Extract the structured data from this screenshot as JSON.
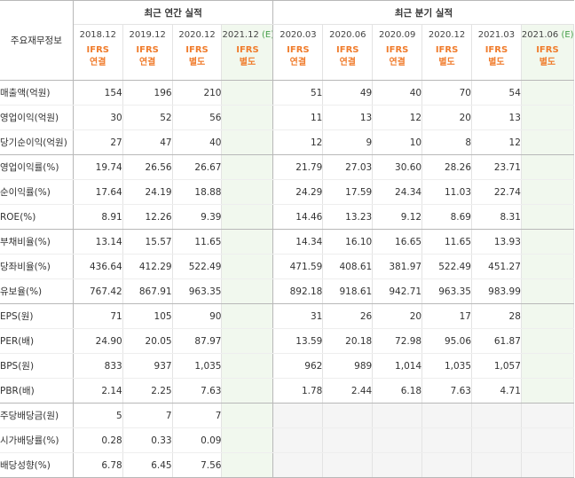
{
  "header": {
    "corner_label": "주요재무정보",
    "annual_label": "최근 연간 실적",
    "quarterly_label": "최근 분기 실적"
  },
  "periods": [
    {
      "label": "2018.12",
      "est": "",
      "acct_top": "IFRS",
      "acct_bottom": "연결",
      "group": "annual"
    },
    {
      "label": "2019.12",
      "est": "",
      "acct_top": "IFRS",
      "acct_bottom": "연결",
      "group": "annual"
    },
    {
      "label": "2020.12",
      "est": "",
      "acct_top": "IFRS",
      "acct_bottom": "별도",
      "group": "annual"
    },
    {
      "label": "2021.12",
      "est": "(E)",
      "acct_top": "IFRS",
      "acct_bottom": "별도",
      "group": "annual"
    },
    {
      "label": "2020.03",
      "est": "",
      "acct_top": "IFRS",
      "acct_bottom": "연결",
      "group": "quarterly"
    },
    {
      "label": "2020.06",
      "est": "",
      "acct_top": "IFRS",
      "acct_bottom": "연결",
      "group": "quarterly"
    },
    {
      "label": "2020.09",
      "est": "",
      "acct_top": "IFRS",
      "acct_bottom": "연결",
      "group": "quarterly"
    },
    {
      "label": "2020.12",
      "est": "",
      "acct_top": "IFRS",
      "acct_bottom": "별도",
      "group": "quarterly"
    },
    {
      "label": "2021.03",
      "est": "",
      "acct_top": "IFRS",
      "acct_bottom": "별도",
      "group": "quarterly"
    },
    {
      "label": "2021.06",
      "est": "(E)",
      "acct_top": "IFRS",
      "acct_bottom": "별도",
      "group": "quarterly"
    }
  ],
  "colors": {
    "accent_orange": "#f07c2c",
    "estimate_green": "#48a04b",
    "estimate_shade": "#f1f8ee",
    "empty_grey": "#f5f5f5"
  },
  "rows": [
    {
      "label": "매출액(억원)",
      "values": [
        "154",
        "196",
        "210",
        "",
        "51",
        "49",
        "40",
        "70",
        "54",
        ""
      ],
      "end_group": false
    },
    {
      "label": "영업이익(억원)",
      "values": [
        "30",
        "52",
        "56",
        "",
        "11",
        "13",
        "12",
        "20",
        "13",
        ""
      ],
      "end_group": false
    },
    {
      "label": "당기순이익(억원)",
      "values": [
        "27",
        "47",
        "40",
        "",
        "12",
        "9",
        "10",
        "8",
        "12",
        ""
      ],
      "end_group": true
    },
    {
      "label": "영업이익률(%)",
      "values": [
        "19.74",
        "26.56",
        "26.67",
        "",
        "21.79",
        "27.03",
        "30.60",
        "28.26",
        "23.71",
        ""
      ],
      "end_group": false
    },
    {
      "label": "순이익률(%)",
      "values": [
        "17.64",
        "24.19",
        "18.88",
        "",
        "24.29",
        "17.59",
        "24.34",
        "11.03",
        "22.74",
        ""
      ],
      "end_group": false
    },
    {
      "label": "ROE(%)",
      "values": [
        "8.91",
        "12.26",
        "9.39",
        "",
        "14.46",
        "13.23",
        "9.12",
        "8.69",
        "8.31",
        ""
      ],
      "end_group": true
    },
    {
      "label": "부채비율(%)",
      "values": [
        "13.14",
        "15.57",
        "11.65",
        "",
        "14.34",
        "16.10",
        "16.65",
        "11.65",
        "13.93",
        ""
      ],
      "end_group": false
    },
    {
      "label": "당좌비율(%)",
      "values": [
        "436.64",
        "412.29",
        "522.49",
        "",
        "471.59",
        "408.61",
        "381.97",
        "522.49",
        "451.27",
        ""
      ],
      "end_group": false
    },
    {
      "label": "유보율(%)",
      "values": [
        "767.42",
        "867.91",
        "963.35",
        "",
        "892.18",
        "918.61",
        "942.71",
        "963.35",
        "983.99",
        ""
      ],
      "end_group": true
    },
    {
      "label": "EPS(원)",
      "values": [
        "71",
        "105",
        "90",
        "",
        "31",
        "26",
        "20",
        "17",
        "28",
        ""
      ],
      "end_group": false
    },
    {
      "label": "PER(배)",
      "values": [
        "24.90",
        "20.05",
        "87.97",
        "",
        "13.59",
        "20.18",
        "72.98",
        "95.06",
        "61.87",
        ""
      ],
      "end_group": false
    },
    {
      "label": "BPS(원)",
      "values": [
        "833",
        "937",
        "1,035",
        "",
        "962",
        "989",
        "1,014",
        "1,035",
        "1,057",
        ""
      ],
      "end_group": false
    },
    {
      "label": "PBR(배)",
      "values": [
        "2.14",
        "2.25",
        "7.63",
        "",
        "1.78",
        "2.44",
        "6.18",
        "7.63",
        "4.71",
        ""
      ],
      "end_group": true
    },
    {
      "label": "주당배당금(원)",
      "values": [
        "5",
        "7",
        "7",
        "",
        "",
        "",
        "",
        "",
        "",
        ""
      ],
      "end_group": false
    },
    {
      "label": "시가배당률(%)",
      "values": [
        "0.28",
        "0.33",
        "0.09",
        "",
        "",
        "",
        "",
        "",
        "",
        ""
      ],
      "end_group": false
    },
    {
      "label": "배당성향(%)",
      "values": [
        "6.78",
        "6.45",
        "7.56",
        "",
        "",
        "",
        "",
        "",
        "",
        ""
      ],
      "end_group": true
    }
  ],
  "grey_quarterly_rows": [
    13,
    14,
    15
  ]
}
